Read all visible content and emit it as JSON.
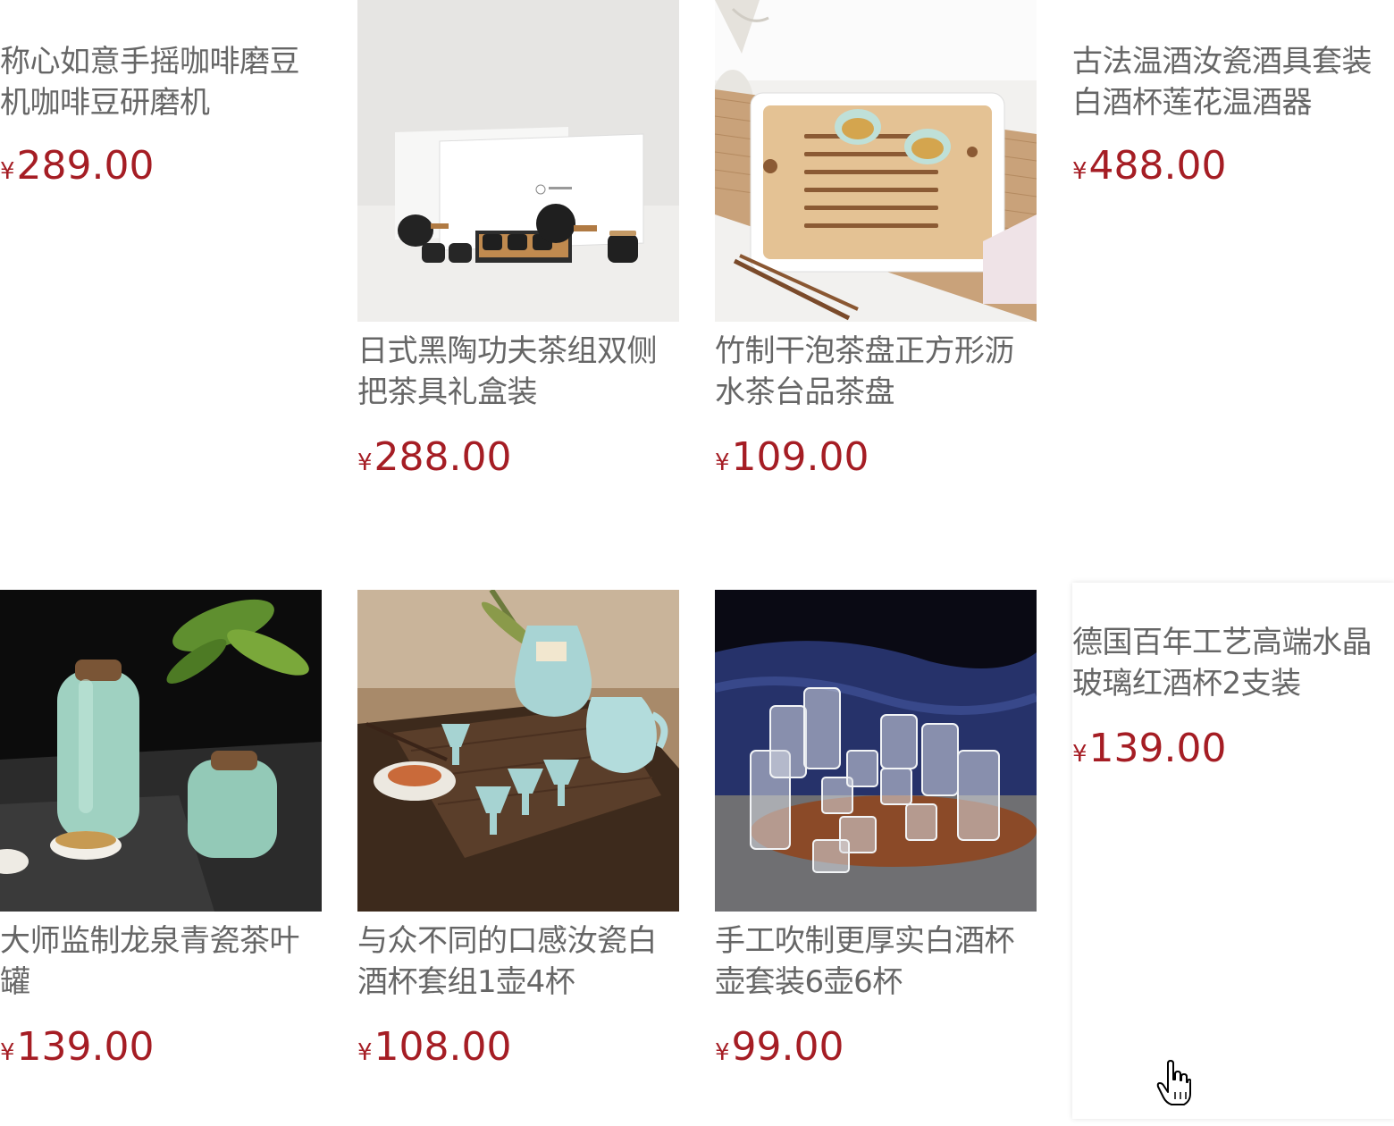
{
  "currency_symbol": "¥",
  "colors": {
    "price": "#a51d24",
    "name": "#666666",
    "background": "#ffffff"
  },
  "products": [
    {
      "name": "称心如意手摇咖啡磨豆机咖啡豆研磨机",
      "price": "289.00",
      "image": "none"
    },
    {
      "name": "日式黑陶功夫茶组双侧把茶具礼盒装",
      "price": "288.00",
      "image": "black-ceramic-tea-set-with-gift-box"
    },
    {
      "name": "竹制干泡茶盘正方形沥水茶台品茶盘",
      "price": "109.00",
      "image": "bamboo-tea-tray-with-cups"
    },
    {
      "name": "古法温酒汝瓷酒具套装白酒杯莲花温酒器",
      "price": "488.00",
      "image": "none"
    },
    {
      "name": "大师监制龙泉青瓷茶叶罐",
      "price": "139.00",
      "image": "celadon-tea-canisters"
    },
    {
      "name": "与众不同的口感汝瓷白酒杯套组1壶4杯",
      "price": "108.00",
      "image": "ru-porcelain-wine-set-on-wooden-tray"
    },
    {
      "name": "手工吹制更厚实白酒杯壶套装6壶6杯",
      "price": "99.00",
      "image": "glass-pitchers-and-shot-glasses"
    },
    {
      "name": "德国百年工艺高端水晶玻璃红酒杯2支装",
      "price": "139.00",
      "image": "none"
    }
  ],
  "cursor": "hand-pointer-icon"
}
